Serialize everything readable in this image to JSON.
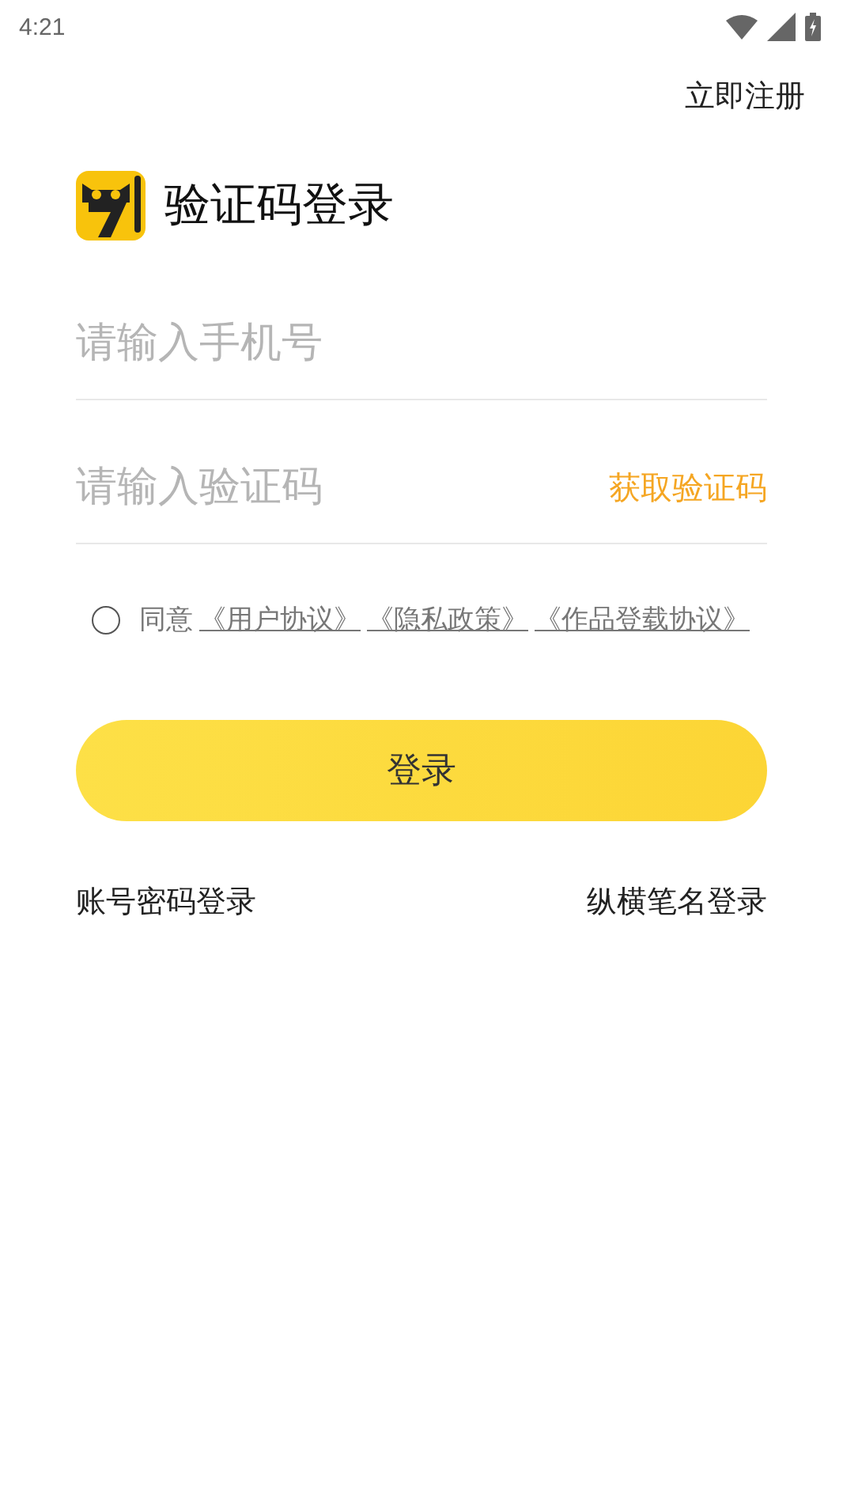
{
  "status_bar": {
    "time": "4:21"
  },
  "register_link": "立即注册",
  "title": "验证码登录",
  "phone_field": {
    "placeholder": "请输入手机号"
  },
  "code_field": {
    "placeholder": "请输入验证码",
    "action": "获取验证码"
  },
  "agreement": {
    "checked": false,
    "text": "同意",
    "links": [
      "《用户协议》",
      "《隐私政策》",
      "《作品登载协议》"
    ]
  },
  "login_button": "登录",
  "alt_logins": [
    "账号密码登录",
    "纵横笔名登录"
  ]
}
